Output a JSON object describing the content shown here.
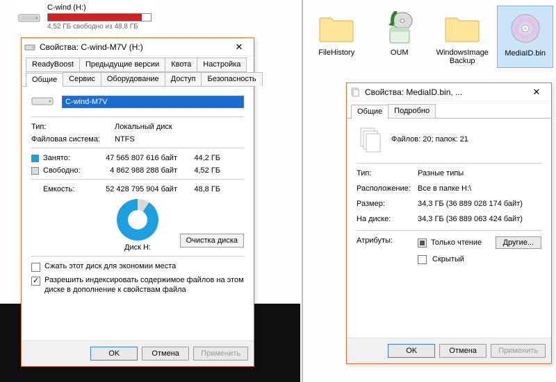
{
  "drive_card": {
    "name": "C-wind (H:)",
    "free_text": "4,52 ГБ свободно из 48,8 ГБ",
    "used_percent": 91
  },
  "left_dialog": {
    "title": "Свойства: C-wind-M7V (H:)",
    "tabs_row1": [
      "ReadyBoost",
      "Предыдущие версии",
      "Квота",
      "Настройка"
    ],
    "tabs_row2": [
      "Общие",
      "Сервис",
      "Оборудование",
      "Доступ",
      "Безопасность"
    ],
    "active_tab": "Общие",
    "volume_name": "C-wind-M7V",
    "type_label": "Тип:",
    "type_value": "Локальный диск",
    "fs_label": "Файловая система:",
    "fs_value": "NTFS",
    "used_label": "Занято:",
    "used_bytes": "47 565 807 616 байт",
    "used_gb": "44,2 ГБ",
    "free_label": "Свободно:",
    "free_bytes": "4 862 988 288 байт",
    "free_gb": "4,52 ГБ",
    "cap_label": "Емкость:",
    "cap_bytes": "52 428 795 904 байт",
    "cap_gb": "48,8 ГБ",
    "disk_caption": "Диск H:",
    "cleanup_btn": "Очистка диска",
    "compress_label": "Сжать этот диск для экономии места",
    "index_label": "Разрешить индексировать содержимое файлов на этом диске в дополнение к свойствам файла",
    "btn_ok": "OK",
    "btn_cancel": "Отмена",
    "btn_apply": "Применить"
  },
  "explorer_items": [
    {
      "name": "FileHistory",
      "kind": "folder"
    },
    {
      "name": "OUM",
      "kind": "cd-drive"
    },
    {
      "name": "WindowsImageBackup",
      "kind": "folder"
    },
    {
      "name": "MediaID.bin",
      "kind": "disc"
    }
  ],
  "right_dialog": {
    "title": "Свойства: MediaID.bin, ...",
    "tabs": [
      "Общие",
      "Подробно"
    ],
    "active_tab": "Общие",
    "summary": "Файлов: 20; папок: 21",
    "type_label": "Тип:",
    "type_value": "Разные типы",
    "loc_label": "Расположение:",
    "loc_value": "Все в папке H:\\",
    "size_label": "Размер:",
    "size_value": "34,3 ГБ (36 889 028 174 байт)",
    "ondisk_label": "На диске:",
    "ondisk_value": "34,3 ГБ (36 889 063 424 байт)",
    "attr_label": "Атрибуты:",
    "ro_label": "Только чтение",
    "hidden_label": "Скрытый",
    "other_btn": "Другие...",
    "btn_ok": "OK",
    "btn_cancel": "Отмена",
    "btn_apply": "Применить"
  },
  "chart_data": {
    "type": "pie",
    "title": "Диск H:",
    "series": [
      {
        "name": "Занято",
        "value_gb": 44.2,
        "value_bytes": 47565807616,
        "color": "#1ba1e2"
      },
      {
        "name": "Свободно",
        "value_gb": 4.52,
        "value_bytes": 4862988288,
        "color": "#d9d9d9"
      }
    ],
    "total_gb": 48.8,
    "total_bytes": 52428795904
  }
}
